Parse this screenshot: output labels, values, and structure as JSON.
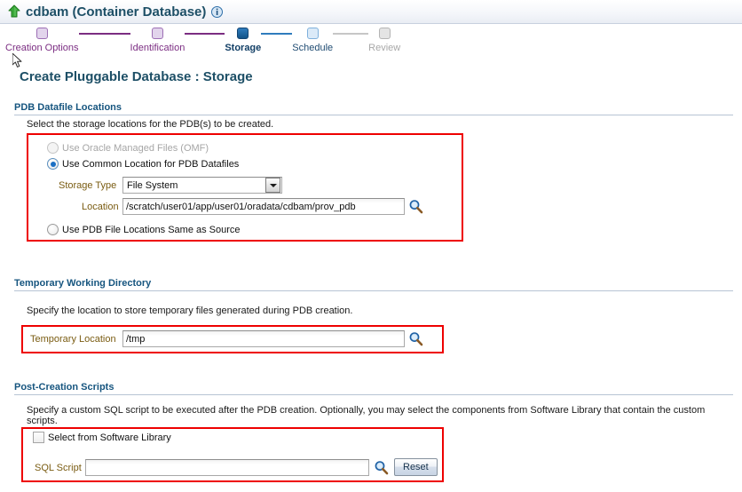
{
  "titlebar": {
    "database_name": "cdbam (Container Database)",
    "status_icon": "green-up-arrow-icon",
    "info_icon": "info-icon"
  },
  "train": {
    "steps": [
      {
        "label": "Creation Options",
        "state": "done"
      },
      {
        "label": "Identification",
        "state": "done"
      },
      {
        "label": "Storage",
        "state": "current"
      },
      {
        "label": "Schedule",
        "state": "next"
      },
      {
        "label": "Review",
        "state": "disabled"
      }
    ]
  },
  "page": {
    "heading": "Create Pluggable Database : Storage"
  },
  "datafile_locations": {
    "section_title": "PDB Datafile Locations",
    "description": "Select the storage locations for the PDB(s) to be created.",
    "radios": [
      {
        "label": "Use Oracle Managed Files (OMF)",
        "checked": false,
        "disabled": true
      },
      {
        "label": "Use Common Location for PDB Datafiles",
        "checked": true,
        "disabled": false
      },
      {
        "label": "Use PDB File Locations Same as Source",
        "checked": false,
        "disabled": false
      }
    ],
    "storage_type_label": "Storage Type",
    "storage_type_value": "File System",
    "location_label": "Location",
    "location_value": "/scratch/user01/app/user01/oradata/cdbam/prov_pdb",
    "location_search_icon": "magnifier-icon"
  },
  "temporary_working_directory": {
    "section_title": "Temporary Working Directory",
    "description": "Specify the location to store temporary files generated during PDB creation.",
    "field_label": "Temporary Location",
    "field_value": "/tmp",
    "search_icon": "magnifier-icon"
  },
  "post_creation_scripts": {
    "section_title": "Post-Creation Scripts",
    "description": "Specify a custom SQL script to be executed after the PDB creation. Optionally, you may select the components from Software Library that contain the custom scripts.",
    "checkbox_label": "Select from Software Library",
    "checkbox_checked": false,
    "sql_script_label": "SQL Script",
    "sql_script_value": "",
    "sql_script_search_icon": "magnifier-icon",
    "reset_button_label": "Reset"
  },
  "highlight_color": "#ee0000"
}
